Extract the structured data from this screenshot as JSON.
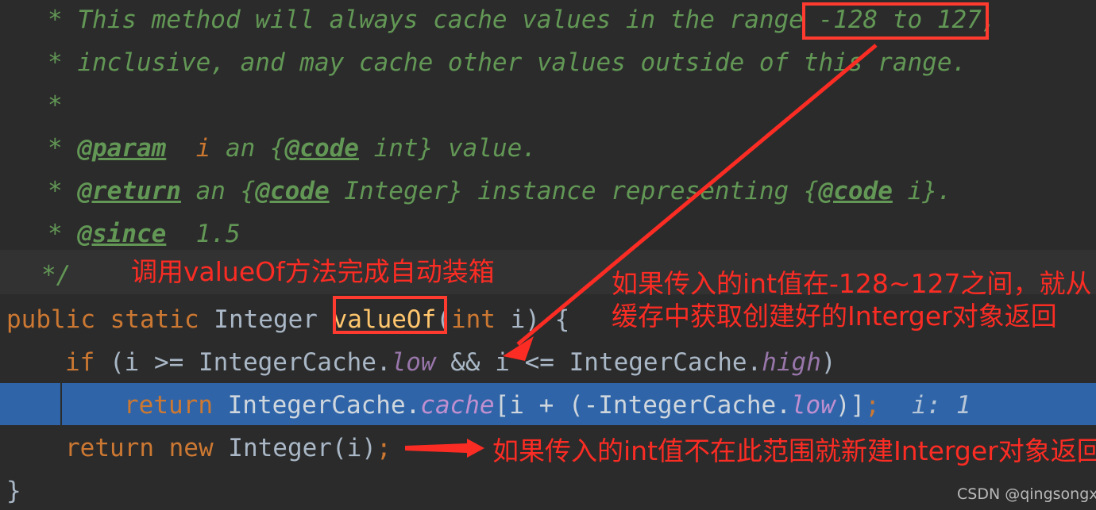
{
  "editor": {
    "background": "#2b2b2b",
    "selection_color": "#2f65a8",
    "caret_line_color": "#323232",
    "annotation_color": "#fb2c24",
    "lines": {
      "l1_star": "*",
      "l1_text": " This method will always cache values in the range ",
      "l1_range": "-128 to 127,",
      "l2": "* inclusive, and may cache other values outside of this range.",
      "l3": "*",
      "l4_star": "* ",
      "l4_tag": "@param",
      "l4_sp": "  ",
      "l4_param": "i",
      "l4_rest": " an {",
      "l4_code": "@code",
      "l4_tail": " int} value.",
      "l5_star": "* ",
      "l5_tag": "@return",
      "l5_mid": " an {",
      "l5_code": "@code",
      "l5_mid2": " Integer} instance representing {",
      "l5_code2": "@code",
      "l5_tail": " i}.",
      "l6_star": "* ",
      "l6_tag": "@since",
      "l6_tail": "  1.5",
      "l7": "*/",
      "l8_kw1": "public static ",
      "l8_type": "Integer ",
      "l8_method": "valueOf",
      "l8_paren1": "(",
      "l8_kwint": "int",
      "l8_arg": " i",
      "l8_paren2": ") {",
      "l9_kw": "if",
      "l9_a": " (i >= IntegerCache.",
      "l9_f1": "low",
      "l9_b": " && i <= IntegerCache.",
      "l9_f2": "high",
      "l9_c": ")",
      "l10_kw": "return",
      "l10_a": " IntegerCache.",
      "l10_f": "cache",
      "l10_b": "[i + (-IntegerCache.",
      "l10_f2": "low",
      "l10_c": ")]",
      "l10_semi": ";",
      "l10_hint": "i: 1",
      "l11_kw1": "return",
      "l11_kw2": " new",
      "l11_a": " Integer(i)",
      "l11_semi": ";",
      "l12": "}"
    }
  },
  "annotations": {
    "note_boxing": "调用valueOf方法完成自动装箱",
    "note_cache_line1": "如果传入的int值在-128~127之间，就从",
    "note_cache_line2": "缓存中获取创建好的Interger对象返回",
    "note_new_object": "如果传入的int值不在此范围就新建Interger对象返回",
    "watermark": "CSDN @qingsongxyz"
  }
}
